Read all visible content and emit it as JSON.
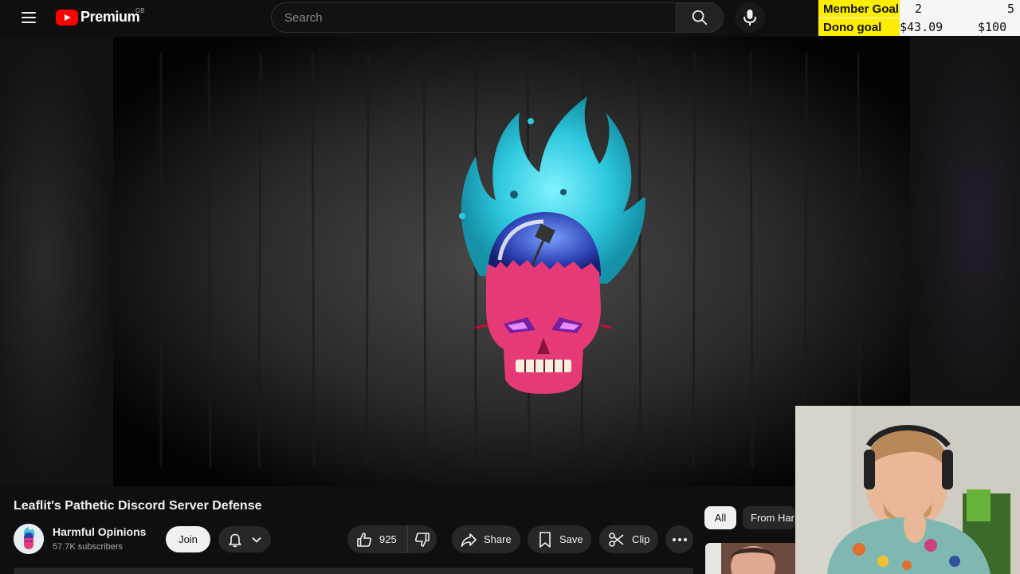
{
  "header": {
    "logo_text": "Premium",
    "region": "GB",
    "search_placeholder": "Search"
  },
  "goals": {
    "member_label": "Member Goal",
    "member_current": "2",
    "member_target": "5",
    "dono_label": "Dono goal",
    "dono_current": "$43.09",
    "dono_target": "$100"
  },
  "video": {
    "title": "Leaflit's Pathetic Discord Server Defense"
  },
  "channel": {
    "name": "Harmful Opinions",
    "subscribers": "57.7K subscribers",
    "join_label": "Join"
  },
  "actions": {
    "like_count": "925",
    "share_label": "Share",
    "save_label": "Save",
    "clip_label": "Clip"
  },
  "chips": {
    "all_label": "All",
    "from_label": "From Har"
  },
  "colors": {
    "brand_red": "#ff0000",
    "goal_yellow": "#fdee00",
    "flame": "#3fd4e6",
    "skull": "#e63a78"
  }
}
